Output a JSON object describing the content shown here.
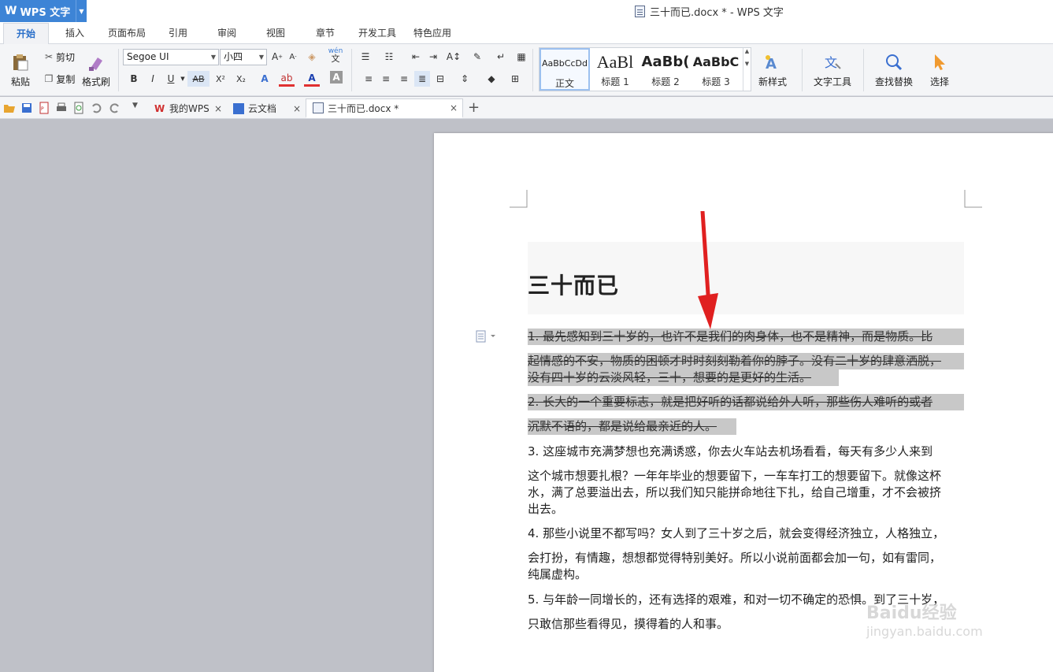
{
  "titlebar": {
    "app_name": "WPS 文字",
    "window_title": "三十而已.docx * - WPS 文字"
  },
  "menu": {
    "tabs": [
      "开始",
      "插入",
      "页面布局",
      "引用",
      "审阅",
      "视图",
      "章节",
      "开发工具",
      "特色应用"
    ],
    "active": "开始"
  },
  "ribbon": {
    "paste": "粘贴",
    "cut": "剪切",
    "copy": "复制",
    "format_painter": "格式刷",
    "font_name": "Segoe UI",
    "font_size": "小四",
    "styles": [
      {
        "preview": "AaBbCcDd",
        "name": "正文"
      },
      {
        "preview": "AaBl",
        "name": "标题 1"
      },
      {
        "preview": "AaBb(",
        "name": "标题 2"
      },
      {
        "preview": "AaBbC",
        "name": "标题 3"
      }
    ],
    "new_style": "新样式",
    "text_tools": "文字工具",
    "find_replace": "查找替换",
    "select": "选择",
    "wen_label": "wén",
    "wen_char": "文"
  },
  "doc_tabs": [
    {
      "label": "我的WPS"
    },
    {
      "label": "云文档"
    },
    {
      "label": "三十而已.docx *"
    }
  ],
  "document": {
    "title": "三十而已",
    "paragraphs": [
      {
        "strike": true,
        "lines": [
          "1. 最先感知到三十岁的，也许不是我们的肉身体，也不是精神，而是物质。比",
          "起情感的不安，物质的困顿才时时刻刻勒着你的脖子。没有二十岁的肆意洒脱，",
          "没有四十岁的云淡风轻，三十，想要的是更好的生活。"
        ]
      },
      {
        "strike": true,
        "lines": [
          "2. 长大的一个重要标志，就是把好听的话都说给外人听，那些伤人难听的或者",
          "沉默不语的，都是说给最亲近的人。"
        ]
      },
      {
        "strike": false,
        "lines": [
          "3. 这座城市充满梦想也充满诱惑，你去火车站去机场看看，每天有多少人来到",
          "这个城市想要扎根？一年年毕业的想要留下，一车车打工的想要留下。就像这杯",
          "水，满了总要溢出去，所以我们知只能拼命地往下扎，给自己增重，才不会被挤",
          "出去。"
        ]
      },
      {
        "strike": false,
        "lines": [
          "4. 那些小说里不都写吗？女人到了三十岁之后，就会变得经济独立，人格独立，",
          "会打扮，有情趣，想想都觉得特别美好。所以小说前面都会加一句，如有雷同，",
          "纯属虚构。"
        ]
      },
      {
        "strike": false,
        "lines": [
          "5. 与年龄一同增长的，还有选择的艰难，和对一切不确定的恐惧。到了三十岁，",
          "只敢信那些看得见，摸得着的人和事。"
        ]
      }
    ]
  },
  "watermark": {
    "brand": "Baidu经验",
    "url": "jingyan.baidu.com"
  },
  "colors": {
    "accent": "#3d84d6",
    "arrow": "#e02020",
    "selection": "#c8c8c8",
    "canvas": "#bfc1c8"
  }
}
